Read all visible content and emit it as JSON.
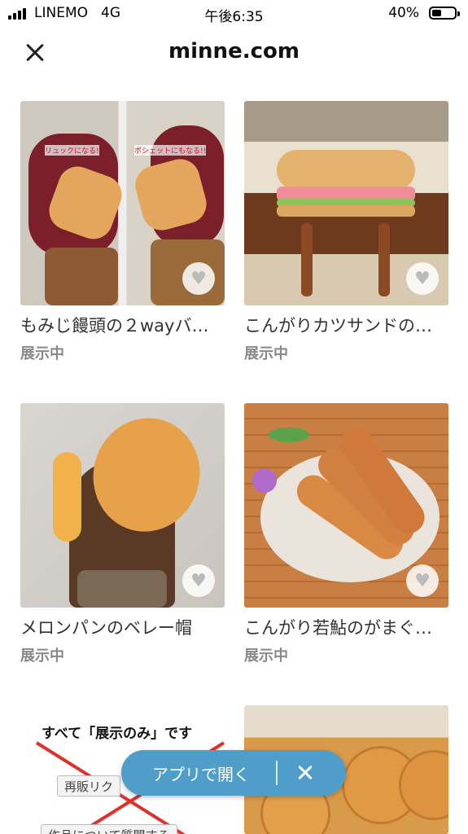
{
  "status_bar": {
    "carrier": "LINEMO",
    "network": "4G",
    "time": "午後6:35",
    "battery": "40%"
  },
  "header": {
    "site": "minne.com"
  },
  "products": [
    {
      "title": "もみじ饅頭の２wayバ…",
      "status": "展示中"
    },
    {
      "title": "こんがりカツサンドの…",
      "status": "展示中"
    },
    {
      "title": "メロンパンのベレー帽",
      "status": "展示中"
    },
    {
      "title": "こんがり若鮎のがまぐ…",
      "status": "展示中"
    }
  ],
  "partial_card": {
    "notice": "すべて「展示のみ」です",
    "btn1": "再販リク",
    "btn2": "作品について質問する"
  },
  "overlay_captions": {
    "c1_left": "リュックになる!",
    "c1_right": "ポシェットにもなる!!"
  },
  "app_banner": {
    "open_label": "アプリで開く"
  },
  "colors": {
    "accent": "#4f9ec9",
    "status_gray": "#888888"
  }
}
